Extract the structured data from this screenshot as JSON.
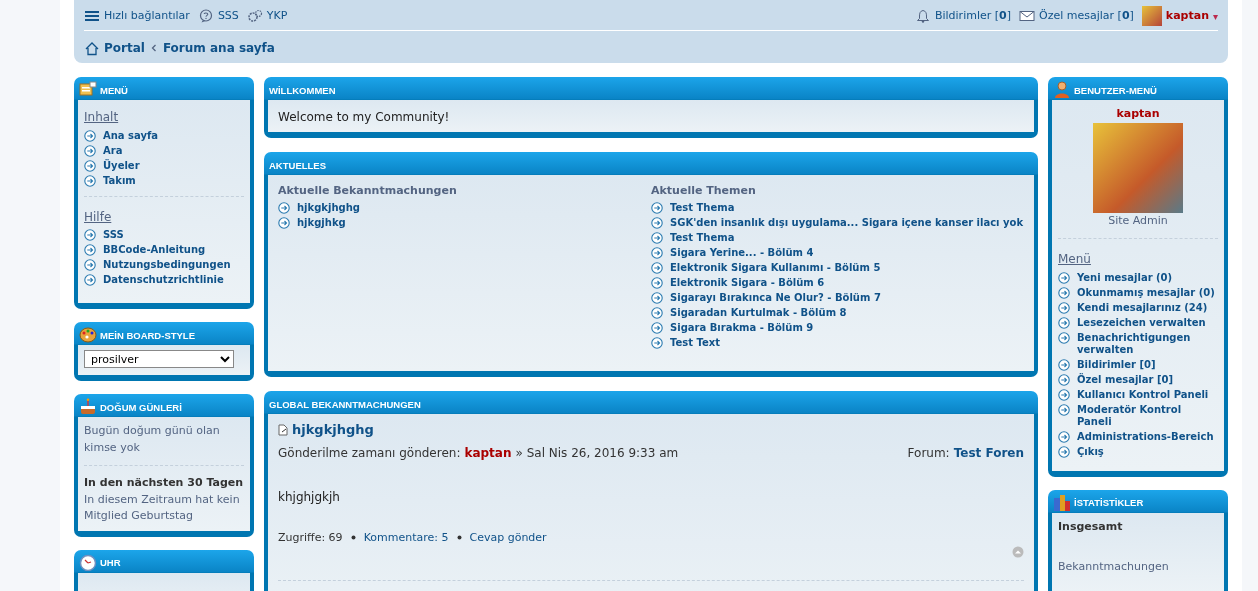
{
  "header": {
    "quick_links": "Hızlı bağlantılar",
    "faq": "SSS",
    "ucp": "YKP",
    "notifications": {
      "label": "Bildirimler",
      "count": "[**0**]"
    },
    "messages": {
      "label": "Özel mesajlar",
      "count": "[**0**]"
    },
    "user": "kaptan",
    "caret": "▾"
  },
  "breadcrumbs": [
    {
      "label": "Portal"
    },
    {
      "label": "Forum ana sayfa"
    }
  ],
  "left": {
    "menu": {
      "title": "MENÜ",
      "sections": [
        {
          "heading": "Inhalt",
          "items": [
            "Ana sayfa",
            "Ara",
            "Üyeler",
            "Takım"
          ]
        },
        {
          "heading": "Hilfe",
          "items": [
            "SSS",
            "BBCode-Anleitung",
            "Nutzungsbedingungen",
            "Datenschutzrichtlinie"
          ]
        }
      ]
    },
    "style": {
      "title": "MEİN BOARD-STYLE",
      "value": "prosilver"
    },
    "birthdays": {
      "title": "DOĞUM GÜNLERİ",
      "today": "Bugün doğum günü olan kimse yok",
      "upcoming_heading": "In den nächsten 30 Tagen",
      "upcoming_text": "In diesem Zeitraum hat kein Mitglied Geburtstag"
    },
    "clock": {
      "title": "UHR"
    }
  },
  "center": {
    "welcome": {
      "title": "WİLLKOMMEN",
      "text": "Welcome to my Community!"
    },
    "news": {
      "title": "AKTUELLES",
      "columns": [
        {
          "heading": "Aktuelle Bekanntmachungen",
          "items": [
            "hjkgkjhghg",
            "hjkgjhkg"
          ]
        },
        {
          "heading": "Aktuelle Themen",
          "items": [
            "Test Thema",
            "SGK'den insanlık dışı uygulama... Sigara içene kanser ilacı yok",
            "Test Thema",
            "Sigara Yerine... - Bölüm 4",
            "Elektronik Sigara Kullanımı - Bölüm 5",
            "Elektronik Sigara - Bölüm 6",
            "Sigarayı Bırakınca Ne Olur? - Bölüm 7",
            "Sigaradan Kurtulmak - Bölüm 8",
            "Sigara Bırakma - Bölüm 9",
            "Test Text"
          ]
        }
      ]
    },
    "global": {
      "title": "GLOBAL BEKANNTMACHUNGEN",
      "topic": "hjkgkjhghg",
      "posted_label": "Gönderilme zamanı gönderen:",
      "author": "kaptan",
      "date": "» Sal Nis 26, 2016 9:33 am",
      "forum_label": "Forum:",
      "forum": "Test Foren",
      "body": "khjghjgkjh",
      "views": "Zugriffe: 69",
      "comments": "Kommentare: 5",
      "reply": "Cevap gönder"
    }
  },
  "right": {
    "user_menu": {
      "title": "BENUTZER-MENÜ",
      "username": "kaptan",
      "rank": "Site Admin",
      "menu_heading": "Menü",
      "items": [
        "Yeni mesajlar (0)",
        "Okunmamış mesajlar (0)",
        "Kendi mesajlarınız (24)",
        "Lesezeichen verwalten",
        "Benachrichtigungen verwalten",
        "Bildirimler [0]",
        "Özel mesajlar [0]",
        "Kullanıcı Kontrol Paneli",
        "Moderatör Kontrol Paneli",
        "Administrations-Bereich",
        "Çıkış"
      ]
    },
    "stats": {
      "title": "İSTATİSTİKLER",
      "heading": "Insgesamt",
      "text": "Bekanntmachungen"
    }
  }
}
